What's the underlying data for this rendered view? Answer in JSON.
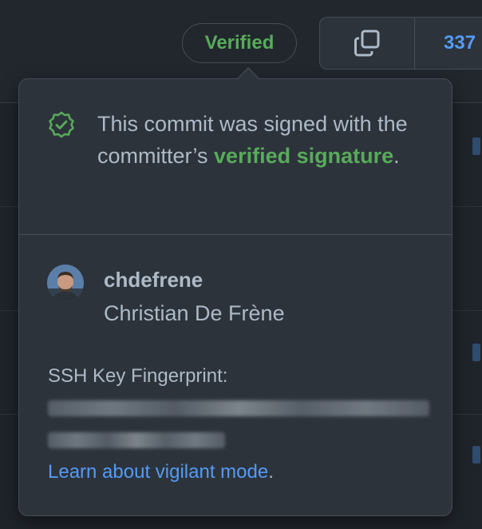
{
  "header": {
    "verified_badge": "Verified",
    "sha_label": "337",
    "copy_icon": "copy-icon"
  },
  "popover": {
    "signed_prefix": "This commit was signed with the committer’s ",
    "signed_link": "verified signature",
    "signed_suffix": ".",
    "status_icon": "verified-shield-icon",
    "username": "chdefrene",
    "full_name": "Christian De Frène",
    "ssh_label": "SSH Key Fingerprint:",
    "learn_link": "Learn about vigilant mode",
    "learn_suffix": "."
  },
  "colors": {
    "accent_green": "#57ab5a",
    "link_blue": "#539bf5",
    "popover_bg": "#2d333b",
    "page_bg": "#1f242b"
  }
}
